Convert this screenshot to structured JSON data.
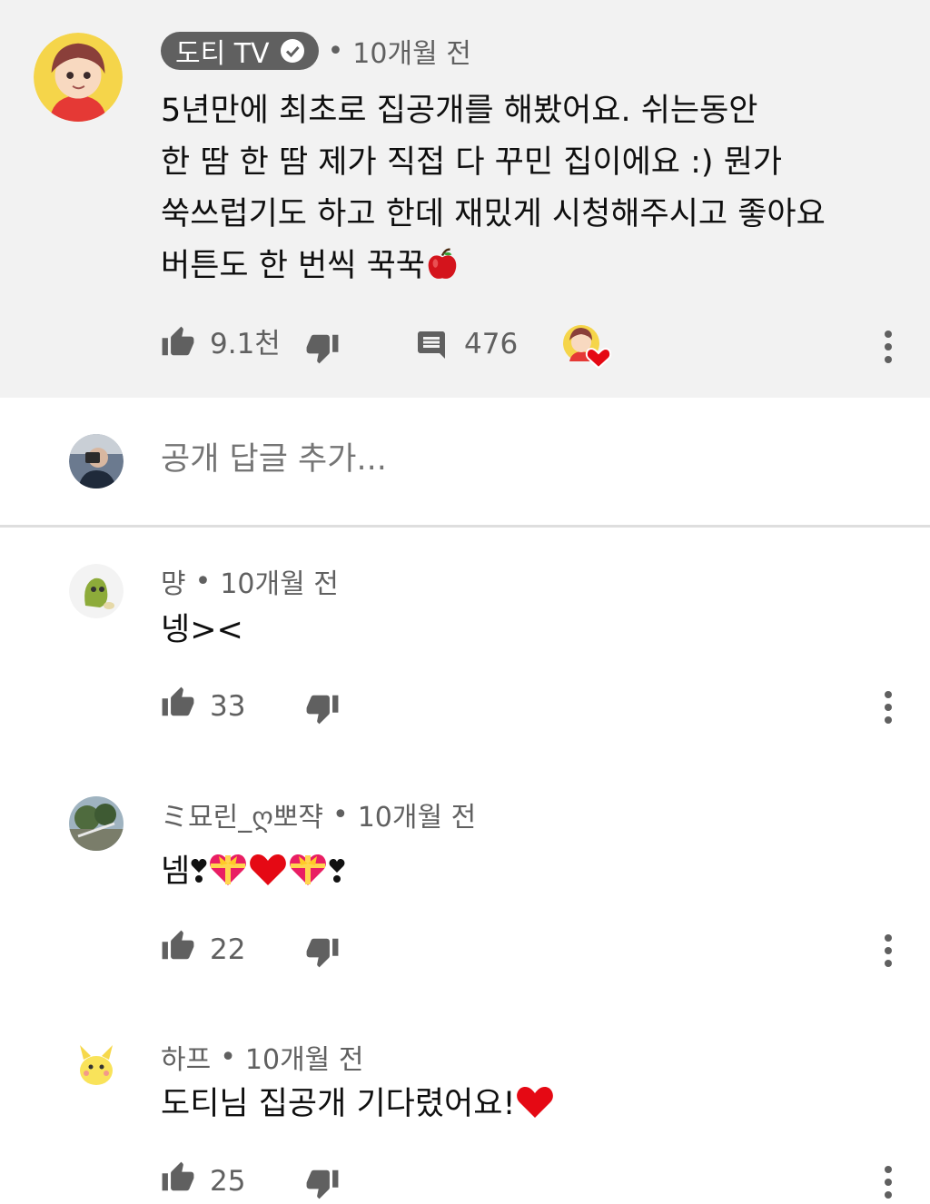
{
  "pinned_comment": {
    "channel_name": "도티 TV",
    "time": "10개월 전",
    "text": "5년만에 최초로 집공개를 해봤어요. 쉬는동안\n한 땀 한 땀 제가 직접 다 꾸민 집이에요 :) 뭔가\n쑥쓰럽기도 하고 한데 재밌게 시청해주시고 좋아요\n버튼도 한 번씩 꾹꾹",
    "emoji": "apple",
    "likes": "9.1천",
    "replies": "476",
    "creator_heart": true
  },
  "reply_box": {
    "placeholder": "공개 답글 추가..."
  },
  "replies": [
    {
      "author": "먕",
      "time": "10개월 전",
      "text": "넹><",
      "likes": "33"
    },
    {
      "author": "ミ묘린_ღ뽀쟉",
      "time": "10개월 전",
      "text": "넴",
      "likes": "22"
    },
    {
      "author": "하프",
      "time": "10개월 전",
      "text": "도티님 집공개 기다렸어요!",
      "likes": "25"
    }
  ],
  "separator": "•",
  "colors": {
    "background_pinned": "#f2f2f2",
    "text_primary": "#0f0f0f",
    "text_secondary": "#606060",
    "heart_red": "#e50914"
  }
}
